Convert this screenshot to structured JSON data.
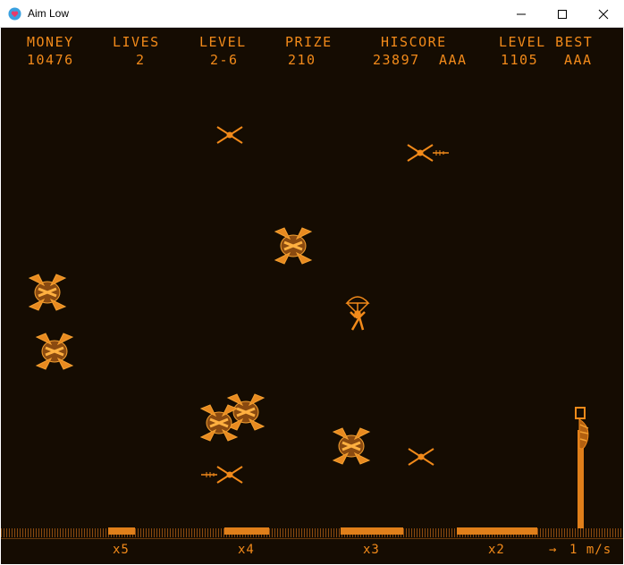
{
  "window": {
    "title": "Aim Low",
    "icon": "heart-app-icon"
  },
  "hud": {
    "money_label": "MONEY",
    "money_value": "10476",
    "lives_label": "LIVES",
    "lives_value": "2",
    "level_label": "LEVEL",
    "level_value": "2-6",
    "prize_label": "PRIZE",
    "prize_value": "210",
    "hiscore_label": "HISCORE",
    "hiscore_value": "23897",
    "hiscore_name": "AAA",
    "level_best_label": "LEVEL BEST",
    "level_best_value": "1105",
    "level_best_name": "AAA"
  },
  "landing_pads": [
    {
      "multiplier": "x5"
    },
    {
      "multiplier": "x4"
    },
    {
      "multiplier": "x3"
    },
    {
      "multiplier": "x2"
    }
  ],
  "wind": {
    "arrow": "→",
    "speed": "1 m/s"
  },
  "colors": {
    "accent": "#f28a1a",
    "background": "#150c02"
  }
}
